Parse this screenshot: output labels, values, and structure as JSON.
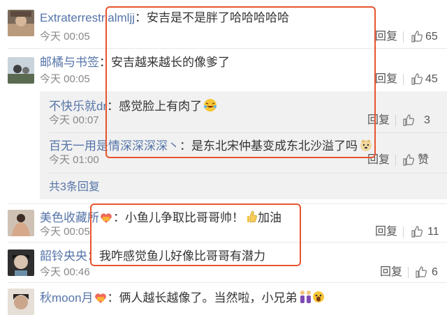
{
  "colors": {
    "username": "#5574a8",
    "timestamp": "#888888",
    "highlight": "#e8542c",
    "subpanel_bg": "#f1f1f1"
  },
  "comments": [
    {
      "user": "Extraterrestrialmljj",
      "text": "安吉是不是胖了哈哈哈哈哈",
      "time": "今天 00:05",
      "reply": "回复",
      "likes": "65"
    },
    {
      "user": "邮橘与书签",
      "text": "安吉越来越长的像爹了",
      "time": "今天 00:05",
      "reply": "回复",
      "likes": "45"
    }
  ],
  "subreplies": [
    {
      "user": "不快乐就dr",
      "text": "感觉脸上有肉了",
      "emoji": "laughing-crying-emoji",
      "time": "今天 00:07",
      "reply": "回复",
      "likes": "3"
    },
    {
      "user": "百无一用是情深深深深丶",
      "text": "是东北宋仲基变成东北沙溢了吗",
      "emoji": "doge-emoji",
      "time": "今天 01:00",
      "reply": "回复",
      "likes": "赞"
    }
  ],
  "more_replies": "共3条回复",
  "comments2": [
    {
      "user": "美色收藏所",
      "badge": "fan-badge",
      "text": "小鱼儿争取比哥哥帅！",
      "emoji": "thumbs-up-emoji",
      "text2": "加油",
      "time": "今天 00:05",
      "reply": "回复",
      "likes": "11"
    },
    {
      "user": "韶铃央央",
      "text": "我咋感觉鱼儿好像比哥哥有潜力",
      "time": "今天 00:46",
      "reply": "回复",
      "likes": "6"
    },
    {
      "user": "秋moon月",
      "badge": "fan-badge",
      "text": "俩人越长越像了。当然啦，小兄弟",
      "emoji": "twins-emoji"
    }
  ]
}
